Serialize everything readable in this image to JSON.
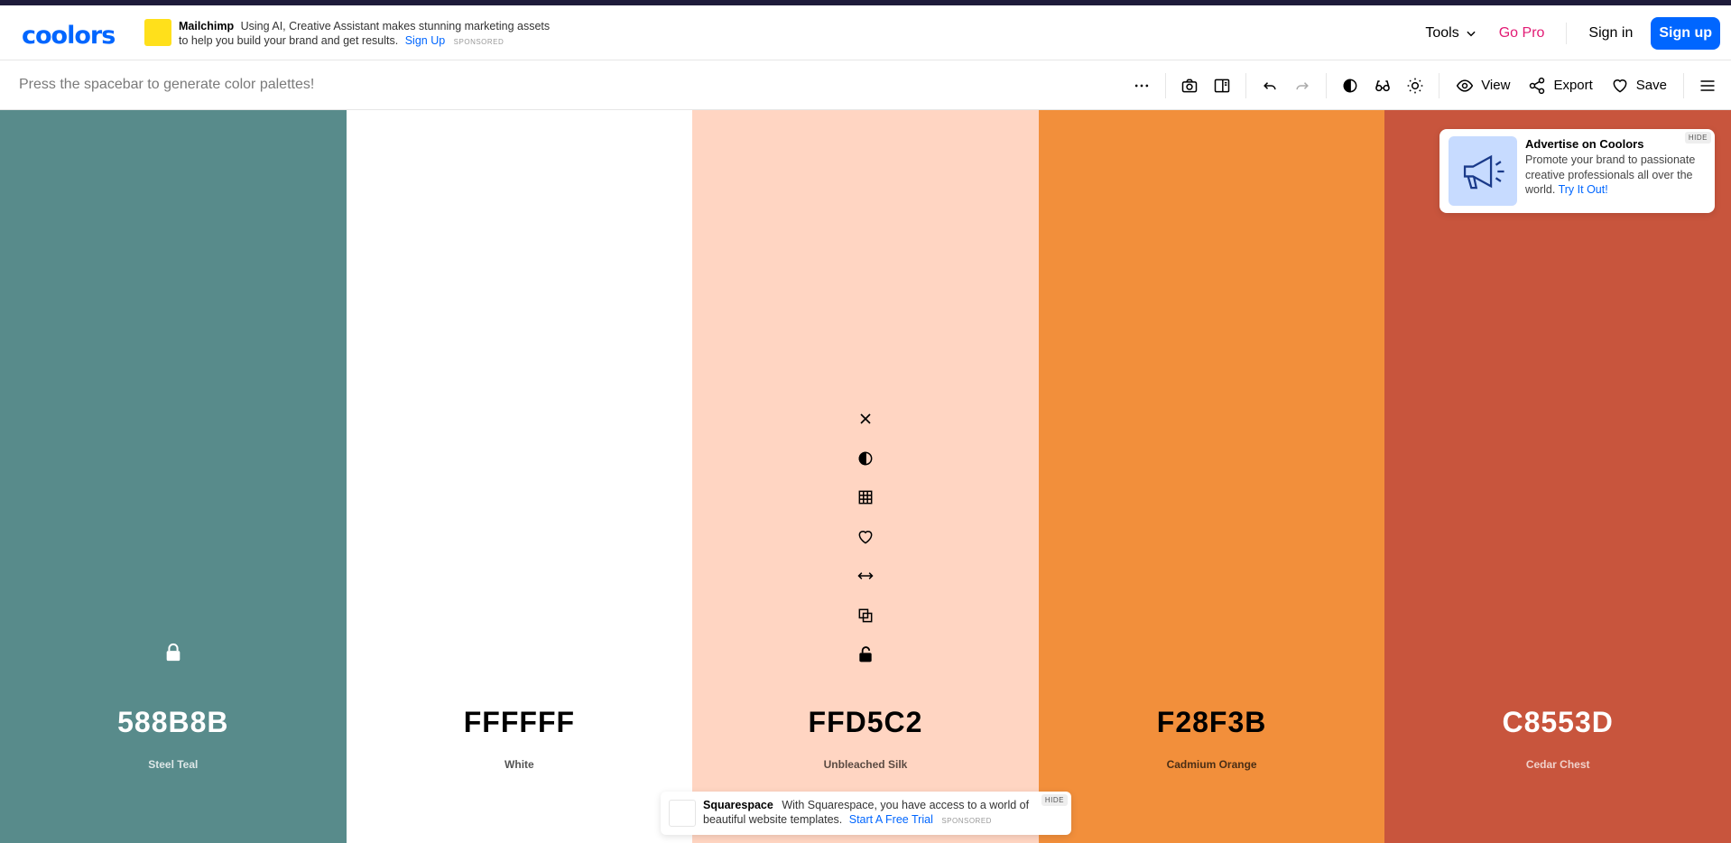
{
  "header": {
    "logo": "coolors",
    "ad": {
      "brand": "Mailchimp",
      "text": "Using AI, Creative Assistant makes stunning marketing assets to help you build your brand and get results.",
      "link": "Sign Up",
      "sponsored": "SPONSORED"
    },
    "nav": {
      "tools": "Tools",
      "gopro": "Go Pro",
      "signin": "Sign in",
      "signup": "Sign up"
    }
  },
  "toolbar": {
    "hint": "Press the spacebar to generate color palettes!",
    "view_label": "View",
    "export_label": "Export",
    "save_label": "Save"
  },
  "palette": {
    "swatches": [
      {
        "hex": "588B8B",
        "name": "Steel Teal",
        "color": "#588B8B",
        "text_color": "#ffffff",
        "name_color": "#dde7e7"
      },
      {
        "hex": "FFFFFF",
        "name": "White",
        "color": "#FFFFFF",
        "text_color": "#000000",
        "name_color": "#555555"
      },
      {
        "hex": "FFD5C2",
        "name": "Unbleached Silk",
        "color": "#FFD5C2",
        "text_color": "#000000",
        "name_color": "#5a4a42"
      },
      {
        "hex": "F28F3B",
        "name": "Cadmium Orange",
        "color": "#F28F3B",
        "text_color": "#000000",
        "name_color": "#4a2e15"
      },
      {
        "hex": "C8553D",
        "name": "Cedar Chest",
        "color": "#C8553D",
        "text_color": "#ffffff",
        "name_color": "#f0d2cb"
      }
    ]
  },
  "ad_right": {
    "title": "Advertise on Coolors",
    "body": "Promote your brand to passionate creative professionals all over the world.",
    "link": "Try It Out!",
    "hide": "HIDE"
  },
  "ad_bottom": {
    "brand": "Squarespace",
    "text": "With Squarespace, you have access to a world of beautiful website templates.",
    "link": "Start A Free Trial",
    "sponsored": "SPONSORED",
    "hide": "HIDE"
  }
}
